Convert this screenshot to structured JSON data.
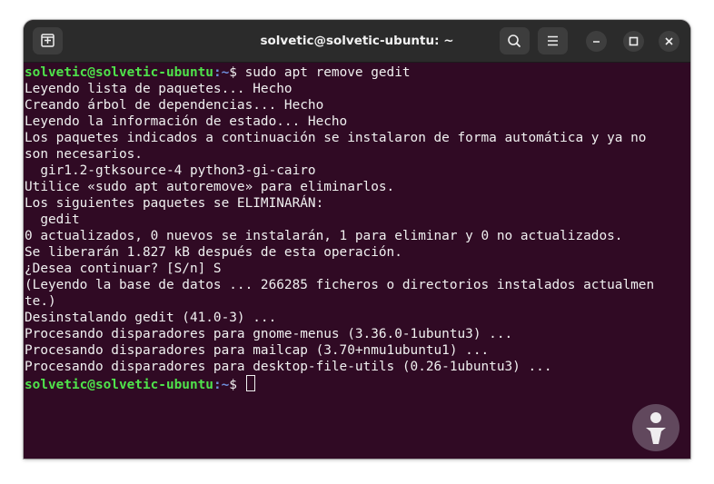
{
  "window": {
    "title": "solvetic@solvetic-ubuntu: ~"
  },
  "titlebar": {
    "new_tab_icon": "new-tab-icon",
    "search_icon": "search-icon",
    "menu_icon": "hamburger-menu-icon",
    "minimize_icon": "minimize-icon",
    "maximize_icon": "maximize-icon",
    "close_icon": "close-icon"
  },
  "terminal": {
    "prompt_user": "solvetic@solvetic-ubuntu",
    "prompt_sep": ":",
    "prompt_path": "~",
    "prompt_symbol": "$ ",
    "command": "sudo apt remove gedit",
    "output": [
      "Leyendo lista de paquetes... Hecho",
      "Creando árbol de dependencias... Hecho",
      "Leyendo la información de estado... Hecho",
      "Los paquetes indicados a continuación se instalaron de forma automática y ya no",
      "son necesarios.",
      "  gir1.2-gtksource-4 python3-gi-cairo",
      "Utilice «sudo apt autoremove» para eliminarlos.",
      "Los siguientes paquetes se ELIMINARÁN:",
      "  gedit",
      "0 actualizados, 0 nuevos se instalarán, 1 para eliminar y 0 no actualizados.",
      "Se liberarán 1.827 kB después de esta operación.",
      "¿Desea continuar? [S/n] S",
      "(Leyendo la base de datos ... 266285 ficheros o directorios instalados actualmen",
      "te.)",
      "Desinstalando gedit (41.0-3) ...",
      "Procesando disparadores para gnome-menus (3.36.0-1ubuntu3) ...",
      "Procesando disparadores para mailcap (3.70+nmu1ubuntu1) ...",
      "Procesando disparadores para desktop-file-utils (0.26-1ubuntu3) ..."
    ]
  },
  "colors": {
    "terminal_bg": "#300a24",
    "titlebar_bg": "#2b2b2b",
    "prompt_user": "#4fe34b",
    "prompt_path": "#6f8fdc",
    "text": "#f0f0f0"
  }
}
